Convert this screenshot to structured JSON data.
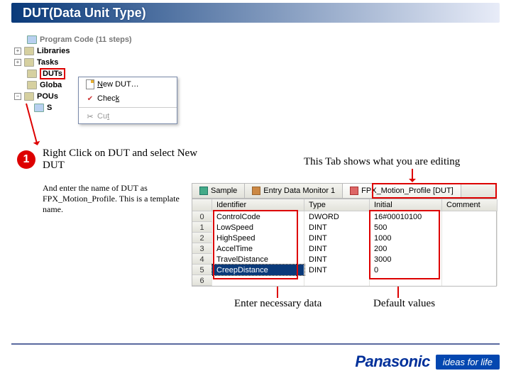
{
  "title": "DUT(Data Unit Type)",
  "tree": {
    "cutoff": "Program Code (11 steps)",
    "items": [
      "Libraries",
      "Tasks",
      "DUTs",
      "Globa",
      "POUs"
    ],
    "pou_child": "S"
  },
  "menu": {
    "new": "New DUT…",
    "new_u": "N",
    "check": "Check",
    "check_u": "k",
    "cut": "Cut",
    "cut_u": "t"
  },
  "step": {
    "num": "1",
    "head": "Right Click on DUT and select New DUT",
    "sub": "And enter the name of DUT as FPX_Motion_Profile.   This is a template name."
  },
  "annot": {
    "tab_note": "This Tab shows what you are editing",
    "enter_data": "Enter necessary data",
    "defaults": "Default values"
  },
  "tabs": {
    "sample": "Sample",
    "monitor": "Entry Data Monitor 1",
    "active": "FPX_Motion_Profile [DUT]"
  },
  "grid": {
    "headers": [
      "",
      "Identifier",
      "Type",
      "Initial",
      "Comment"
    ],
    "rows": [
      {
        "n": "0",
        "ident": "ControlCode",
        "type": "DWORD",
        "init": "16#00010100"
      },
      {
        "n": "1",
        "ident": "LowSpeed",
        "type": "DINT",
        "init": "500"
      },
      {
        "n": "2",
        "ident": "HighSpeed",
        "type": "DINT",
        "init": "1000"
      },
      {
        "n": "3",
        "ident": "AccelTime",
        "type": "DINT",
        "init": "200"
      },
      {
        "n": "4",
        "ident": "TravelDistance",
        "type": "DINT",
        "init": "3000"
      },
      {
        "n": "5",
        "ident": "CreepDistance",
        "type": "DINT",
        "init": "0"
      },
      {
        "n": "6",
        "ident": "",
        "type": "",
        "init": ""
      }
    ]
  },
  "footer": {
    "brand": "Panasonic",
    "tagline": "ideas for life"
  },
  "chart_data": {
    "type": "table",
    "title": "FPX_Motion_Profile [DUT]",
    "columns": [
      "Identifier",
      "Type",
      "Initial",
      "Comment"
    ],
    "rows": [
      [
        "ControlCode",
        "DWORD",
        "16#00010100",
        ""
      ],
      [
        "LowSpeed",
        "DINT",
        "500",
        ""
      ],
      [
        "HighSpeed",
        "DINT",
        "1000",
        ""
      ],
      [
        "AccelTime",
        "DINT",
        "200",
        ""
      ],
      [
        "TravelDistance",
        "DINT",
        "3000",
        ""
      ],
      [
        "CreepDistance",
        "DINT",
        "0",
        ""
      ]
    ]
  }
}
